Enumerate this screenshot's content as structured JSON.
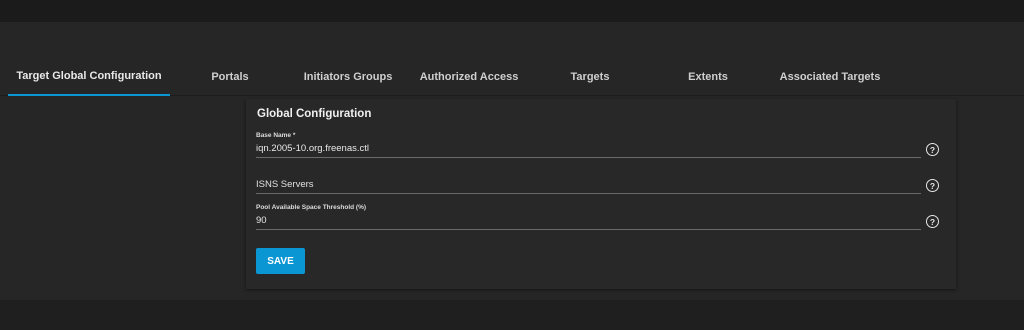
{
  "tabs": [
    {
      "label": "Target Global Configuration",
      "active": true
    },
    {
      "label": "Portals"
    },
    {
      "label": "Initiators Groups"
    },
    {
      "label": "Authorized Access"
    },
    {
      "label": "Targets"
    },
    {
      "label": "Extents"
    },
    {
      "label": "Associated Targets"
    }
  ],
  "card": {
    "title": "Global Configuration",
    "fields": {
      "base_name": {
        "label": "Base Name *",
        "value": "iqn.2005-10.org.freenas.ctl"
      },
      "isns_servers": {
        "placeholder": "ISNS Servers",
        "value": ""
      },
      "pool_threshold": {
        "label": "Pool Available Space Threshold (%)",
        "value": "90"
      }
    },
    "save_label": "SAVE"
  },
  "colors": {
    "accent": "#0a95d3",
    "background": "#262626",
    "card": "#282828"
  },
  "icons": {
    "help": "help-circle-icon"
  }
}
